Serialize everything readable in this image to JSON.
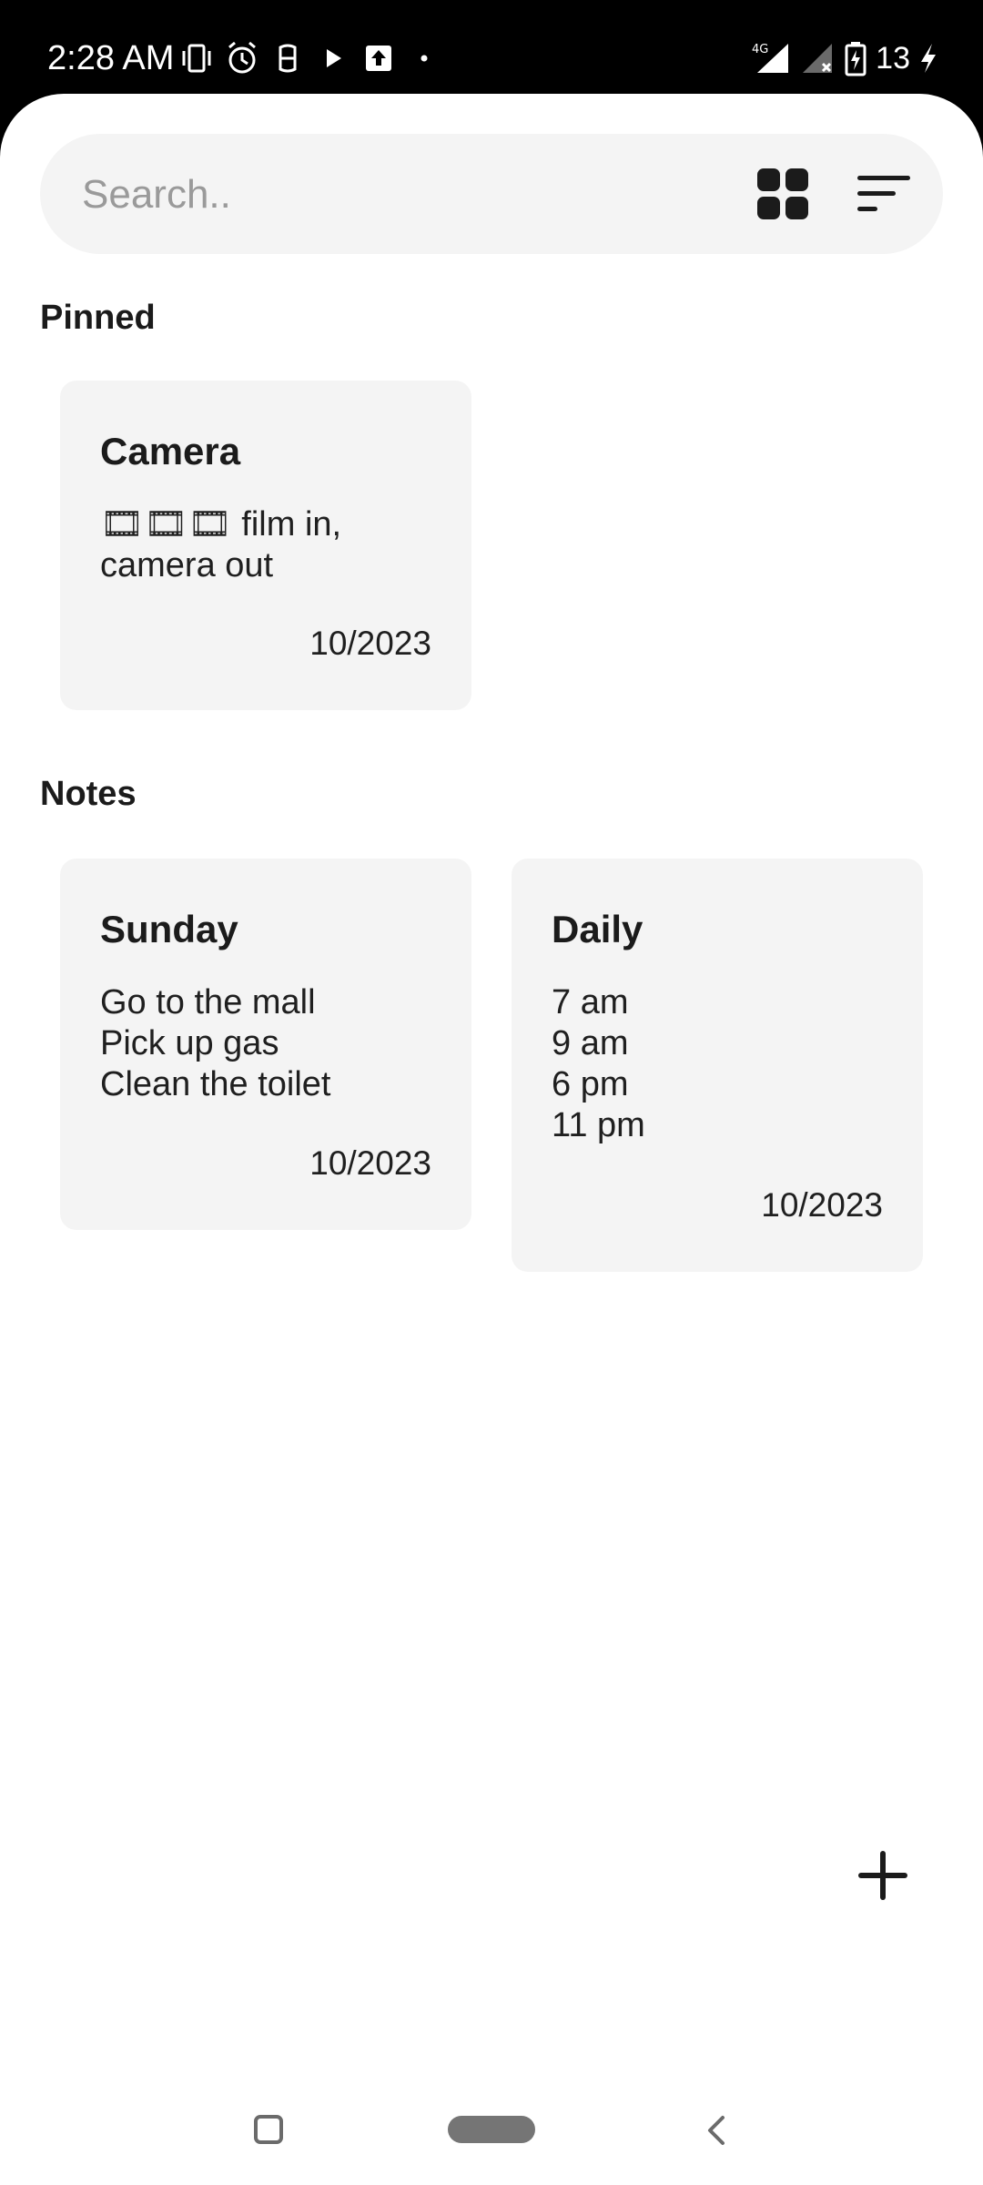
{
  "status_bar": {
    "time": "2:28 AM",
    "left_icons": [
      "vibrate-icon",
      "alarm-icon",
      "app-notification-icon",
      "play-store-icon",
      "upload-icon",
      "more-dot-icon"
    ],
    "network_label": "4G",
    "battery_level": "13"
  },
  "search": {
    "placeholder": "Search..",
    "value": "",
    "view_icon": "grid-view-icon",
    "sort_icon": "sort-icon"
  },
  "sections": {
    "pinned_label": "Pinned",
    "notes_label": "Notes"
  },
  "pinned_notes": [
    {
      "title": "Camera",
      "body": "🎞🎞🎞 film in,\ncamera out",
      "date": "10/2023"
    }
  ],
  "notes": [
    {
      "title": "Sunday",
      "body": "Go to the mall\nPick up gas\nClean the toilet",
      "date": "10/2023"
    },
    {
      "title": "Daily",
      "body": "7 am\n9 am\n6 pm\n11 pm",
      "date": "10/2023"
    }
  ],
  "fab": {
    "icon": "plus-icon"
  },
  "nav": {
    "recents_icon": "recents-icon",
    "home_icon": "home-pill-icon",
    "back_icon": "back-icon"
  },
  "colors": {
    "background": "#ffffff",
    "card": "#f4f4f4",
    "text": "#1b1b1b",
    "placeholder": "#9a9a9a",
    "status_bar": "#000000"
  }
}
